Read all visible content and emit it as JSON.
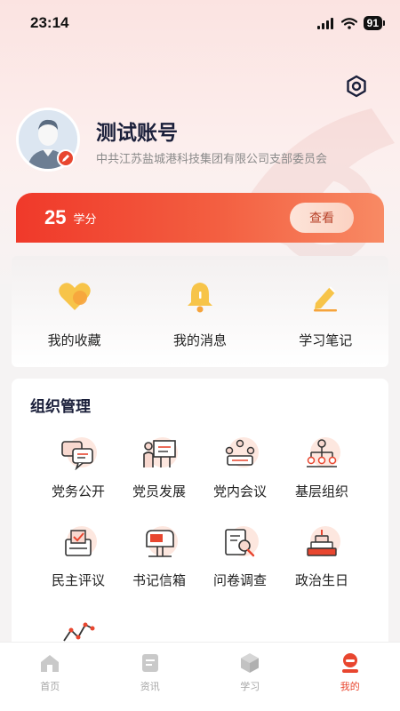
{
  "status_bar": {
    "time": "23:14",
    "battery": "91"
  },
  "profile": {
    "account_name": "测试账号",
    "org_name": "中共江苏盐城港科技集团有限公司支部委员会"
  },
  "credits": {
    "value": "25",
    "unit": "学分",
    "view_label": "查看"
  },
  "quick_actions": [
    {
      "label": "我的收藏",
      "icon": "heart-icon"
    },
    {
      "label": "我的消息",
      "icon": "bell-icon"
    },
    {
      "label": "学习笔记",
      "icon": "pencil-icon"
    }
  ],
  "org_management": {
    "title": "组织管理",
    "items": [
      {
        "label": "党务公开",
        "icon": "chat-bubbles-icon"
      },
      {
        "label": "党员发展",
        "icon": "presenter-board-icon"
      },
      {
        "label": "党内会议",
        "icon": "meeting-table-icon"
      },
      {
        "label": "基层组织",
        "icon": "org-tree-icon"
      },
      {
        "label": "民主评议",
        "icon": "ballot-box-icon"
      },
      {
        "label": "书记信箱",
        "icon": "mailbox-icon"
      },
      {
        "label": "问卷调查",
        "icon": "survey-search-icon"
      },
      {
        "label": "政治生日",
        "icon": "birthday-cake-icon"
      },
      {
        "label": "",
        "icon": "trend-line-icon"
      }
    ]
  },
  "tabs": [
    {
      "label": "首页",
      "icon": "home-icon",
      "active": false
    },
    {
      "label": "资讯",
      "icon": "news-icon",
      "active": false
    },
    {
      "label": "学习",
      "icon": "cube-icon",
      "active": false
    },
    {
      "label": "我的",
      "icon": "profile-icon",
      "active": true
    }
  ],
  "colors": {
    "accent": "#e8462f",
    "title": "#1a1f3a"
  }
}
